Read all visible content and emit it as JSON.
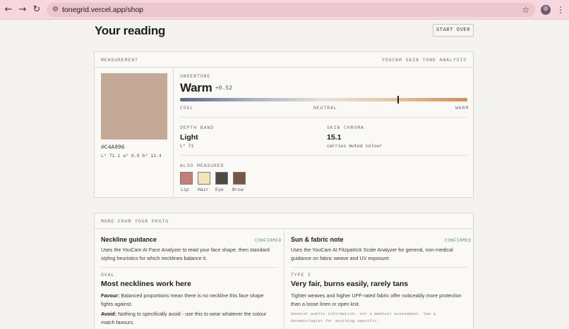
{
  "browser": {
    "url": "tonegrid.vercel.app/shop",
    "back_icon": "←",
    "forward_icon": "→",
    "reload_icon": "↻",
    "site_info_icon": "⚙",
    "star_icon": "☆",
    "menu_icon": "⋮"
  },
  "page": {
    "title": "Your reading",
    "start_over": "START OVER"
  },
  "measurement": {
    "header": "MEASUREMENT",
    "source": "YOUCAM SKIN TONE ANALYSIS",
    "swatch_color": "#C4A996",
    "hex": "#C4A996",
    "lab": "L* 71.1 a* 6.8 b* 13.4",
    "undertone": {
      "label": "UNDERTONE",
      "value": "Warm",
      "score": "+0.52",
      "score_fraction": 0.76,
      "scale_cool": "COOL",
      "scale_neutral": "NEUTRAL",
      "scale_warm": "WARM"
    },
    "depth": {
      "label": "DEPTH BAND",
      "value": "Light",
      "sub": "L* 71"
    },
    "chroma": {
      "label": "SKIN CHROMA",
      "value": "15.1",
      "sub": "carries muted colour"
    },
    "also": {
      "label": "ALSO MEASURED",
      "items": [
        {
          "label": "Lip",
          "color": "#C47E78"
        },
        {
          "label": "Hair",
          "color": "#F3E5B6"
        },
        {
          "label": "Eye",
          "color": "#4C4A44"
        },
        {
          "label": "Brow",
          "color": "#7A5742"
        }
      ]
    }
  },
  "more": {
    "header": "MORE FROM YOUR PHOTO",
    "left": {
      "title": "Neckline guidance",
      "badge": "CONFIRMED",
      "desc": "Uses the YouCam AI Face Analyzer to read your face shape, then standard styling heuristics for which necklines balance it.",
      "tag": "OVAL",
      "headline": "Most necklines work here",
      "favour_key": "Favour:",
      "favour_text": "Balanced proportions mean there is no neckline this face shape fights against.",
      "avoid_key": "Avoid:",
      "avoid_text": "Nothing to specifically avoid - use this to wear whatever the colour match favours."
    },
    "right": {
      "title": "Sun & fabric note",
      "badge": "CONFIRMED",
      "desc": "Uses the YouCam AI Fitzpatrick Scale Analyzer for general, non-medical guidance on fabric weave and UV exposure.",
      "tag": "TYPE I",
      "headline": "Very fair, burns easily, rarely tans",
      "body": "Tighter weaves and higher UPF-rated fabric offer noticeably more protection than a loose linen or open knit.",
      "fine": "General public information, not a medical assessment. See a dermatologist for anything specific."
    }
  }
}
